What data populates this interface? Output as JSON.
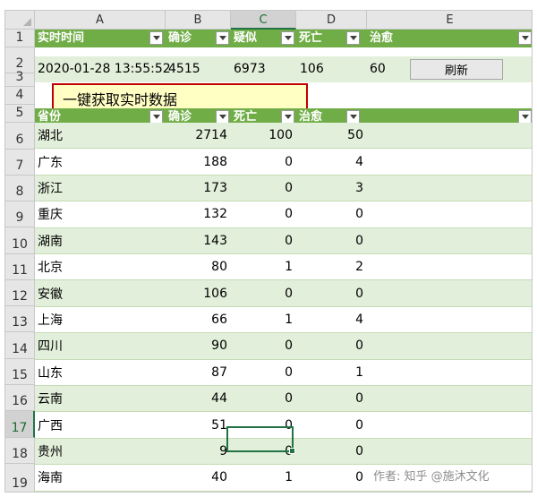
{
  "columns": [
    "A",
    "B",
    "C",
    "D",
    "E"
  ],
  "selected_column": "C",
  "row_numbers": [
    "1",
    "2",
    "3",
    "4",
    "5",
    "6",
    "7",
    "8",
    "9",
    "10",
    "11",
    "12",
    "13",
    "14",
    "15",
    "16",
    "17",
    "18",
    "19"
  ],
  "selected_row": "17",
  "summary_header": [
    "实时时间",
    "确诊",
    "疑似",
    "死亡",
    "治愈"
  ],
  "summary_values": {
    "time": "2020-01-28 13:55:52",
    "confirmed": "4515",
    "suspected": "6973",
    "deaths": "106",
    "cured": "60"
  },
  "refresh_button": "刷新",
  "fetch_button": "一键获取实时数据",
  "province_header": [
    "省份",
    "确诊",
    "死亡",
    "治愈"
  ],
  "provinces": [
    {
      "name": "湖北",
      "confirmed": "2714",
      "deaths": "100",
      "cured": "50"
    },
    {
      "name": "广东",
      "confirmed": "188",
      "deaths": "0",
      "cured": "4"
    },
    {
      "name": "浙江",
      "confirmed": "173",
      "deaths": "0",
      "cured": "3"
    },
    {
      "name": "重庆",
      "confirmed": "132",
      "deaths": "0",
      "cured": "0"
    },
    {
      "name": "湖南",
      "confirmed": "143",
      "deaths": "0",
      "cured": "0"
    },
    {
      "name": "北京",
      "confirmed": "80",
      "deaths": "1",
      "cured": "2"
    },
    {
      "name": "安徽",
      "confirmed": "106",
      "deaths": "0",
      "cured": "0"
    },
    {
      "name": "上海",
      "confirmed": "66",
      "deaths": "1",
      "cured": "4"
    },
    {
      "name": "四川",
      "confirmed": "90",
      "deaths": "0",
      "cured": "0"
    },
    {
      "name": "山东",
      "confirmed": "87",
      "deaths": "0",
      "cured": "1"
    },
    {
      "name": "云南",
      "confirmed": "44",
      "deaths": "0",
      "cured": "0"
    },
    {
      "name": "广西",
      "confirmed": "51",
      "deaths": "0",
      "cured": "0"
    },
    {
      "name": "贵州",
      "confirmed": "9",
      "deaths": "0",
      "cured": "0"
    },
    {
      "name": "海南",
      "confirmed": "40",
      "deaths": "1",
      "cured": "0"
    }
  ],
  "watermark": "作者: 知乎 @施沐文化",
  "colors": {
    "header_green": "#70ad47",
    "band_green": "#e2efda",
    "select_green": "#217346",
    "button_border": "#c00000",
    "button_fill": "#ffffc4"
  }
}
